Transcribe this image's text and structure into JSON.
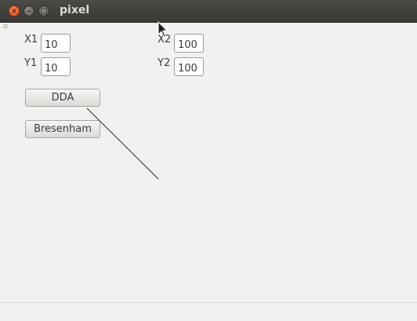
{
  "window": {
    "title": "pixel"
  },
  "form": {
    "x1": {
      "label": "X1",
      "value": "10"
    },
    "y1": {
      "label": "Y1",
      "value": "10"
    },
    "x2": {
      "label": "X2",
      "value": "100"
    },
    "y2": {
      "label": "Y2",
      "value": "100"
    }
  },
  "buttons": {
    "dda": "DDA",
    "bresenham": "Bresenham"
  },
  "titlebar_buttons": {
    "close": "×",
    "minimize": "–",
    "maximize": "□"
  },
  "colors": {
    "titlebar": "#3c3b37",
    "close": "#df4a16",
    "background": "#f2f1f0"
  }
}
